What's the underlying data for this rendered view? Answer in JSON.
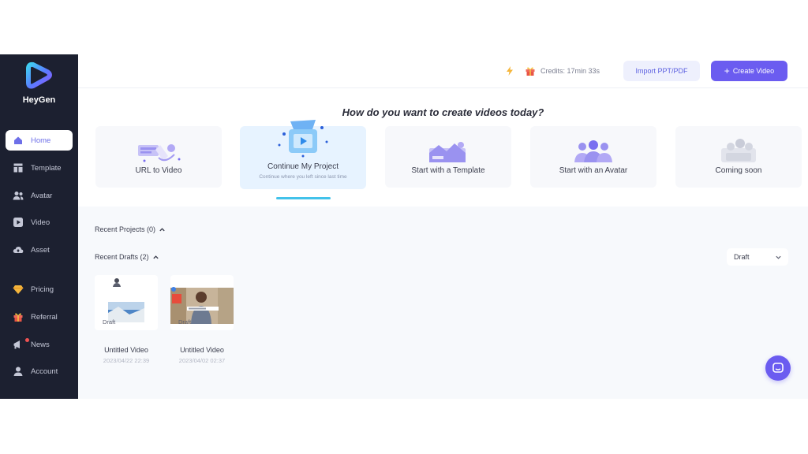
{
  "brand": {
    "name": "HeyGen"
  },
  "sidebar": {
    "items": [
      {
        "label": "Home",
        "icon": "home-icon",
        "active": true
      },
      {
        "label": "Template",
        "icon": "template-icon"
      },
      {
        "label": "Avatar",
        "icon": "avatar-icon"
      },
      {
        "label": "Video",
        "icon": "video-icon"
      },
      {
        "label": "Asset",
        "icon": "cloud-icon"
      },
      {
        "label": "Pricing",
        "icon": "diamond-icon"
      },
      {
        "label": "Referral",
        "icon": "gift-icon"
      },
      {
        "label": "News",
        "icon": "megaphone-icon"
      },
      {
        "label": "Account",
        "icon": "account-icon"
      }
    ]
  },
  "header": {
    "credits": "Credits: 17min 33s",
    "import_label": "Import PPT/PDF",
    "create_label": "Create Video",
    "create_icon": "+"
  },
  "main": {
    "headline": "How do you want to create videos today?",
    "cards": [
      {
        "label": "URL to Video"
      },
      {
        "label": "Continue My Project",
        "sub": "Continue where you left since last time"
      },
      {
        "label": "Start with a Template"
      },
      {
        "label": "Start with an Avatar"
      },
      {
        "label": "Coming soon"
      }
    ],
    "recent_projects": "Recent Projects (0)",
    "recent_drafts": "Recent Drafts (2)",
    "filter": "Draft",
    "drafts": [
      {
        "title": "Untitled Video",
        "date": "2023/04/22 22:39",
        "tag": "Draft"
      },
      {
        "title": "Untitled Video",
        "date": "2023/04/02 02:37",
        "tag": "Draft"
      }
    ]
  },
  "colors": {
    "sidebar": "#1c2030",
    "accent": "#6b5cf0",
    "selected_card": "#e7f3ff"
  }
}
